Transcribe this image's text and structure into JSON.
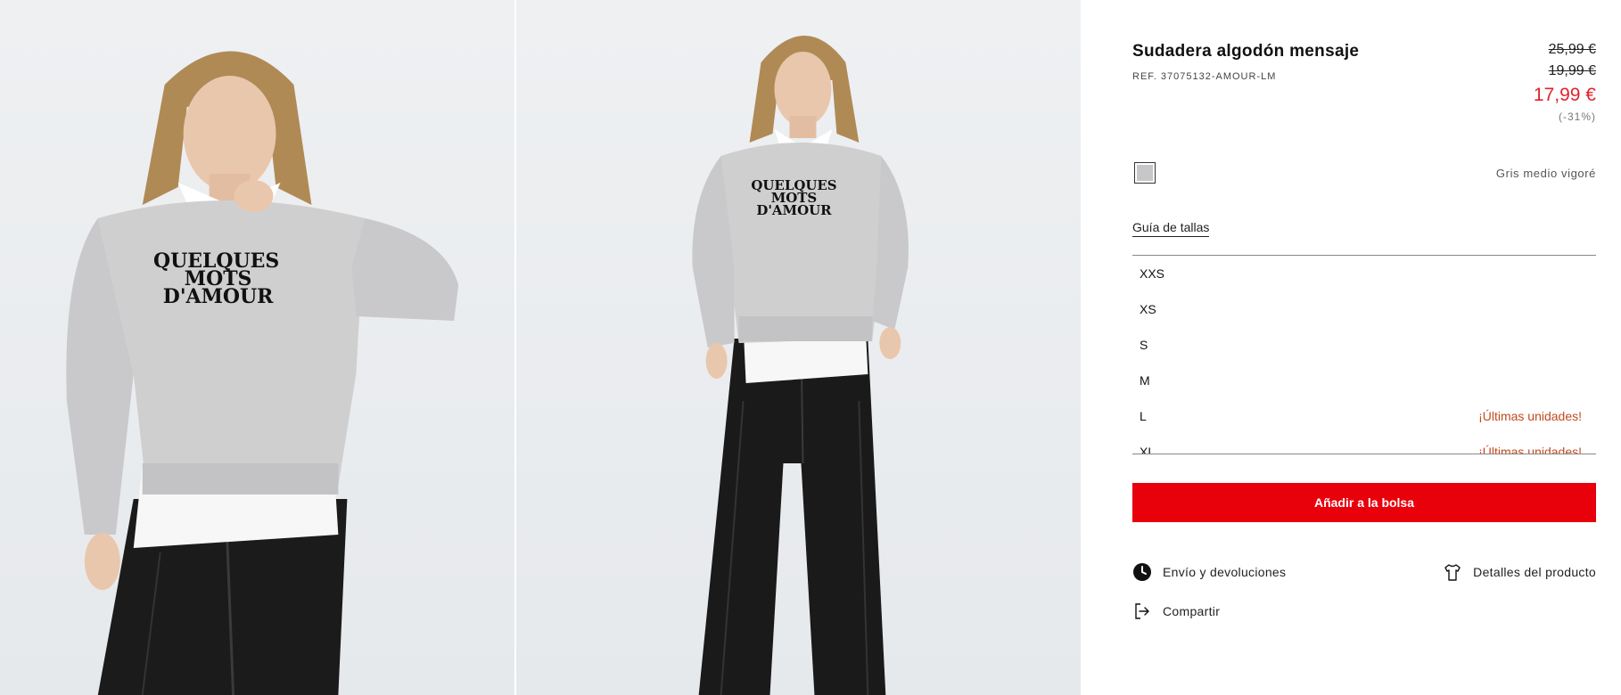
{
  "gallery": {
    "images": [
      {
        "alt": "Sudadera algodón mensaje - vista frontal cercana",
        "print_lines": [
          "QUELQUES",
          "MOTS",
          "D'AMOUR"
        ]
      },
      {
        "alt": "Sudadera algodón mensaje - vista cuerpo entero",
        "print_lines": [
          "QUELQUES",
          "MOTS",
          "D'AMOUR"
        ]
      }
    ]
  },
  "product": {
    "title": "Sudadera algodón mensaje",
    "ref": "REF. 37075132-AMOUR-LM",
    "prices": {
      "original": "25,99 €",
      "previous": "19,99 €",
      "current": "17,99 €",
      "discount": "(-31%)"
    },
    "color": {
      "name": "Gris medio vigoré",
      "swatch_hex": "#c7c7c9"
    },
    "size_guide_label": "Guía de tallas",
    "sizes": [
      {
        "label": "XXS",
        "note": ""
      },
      {
        "label": "XS",
        "note": ""
      },
      {
        "label": "S",
        "note": ""
      },
      {
        "label": "M",
        "note": ""
      },
      {
        "label": "L",
        "note": "¡Últimas unidades!"
      },
      {
        "label": "XL",
        "note": "¡Últimas unidades!"
      }
    ],
    "add_to_bag_label": "Añadir a la bolsa",
    "actions": {
      "shipping": "Envío y devoluciones",
      "details": "Detalles del producto",
      "share": "Compartir"
    }
  },
  "colors": {
    "accent_red": "#e8000b",
    "sale_price": "#e0242b",
    "stock_warning": "#c24a20"
  }
}
